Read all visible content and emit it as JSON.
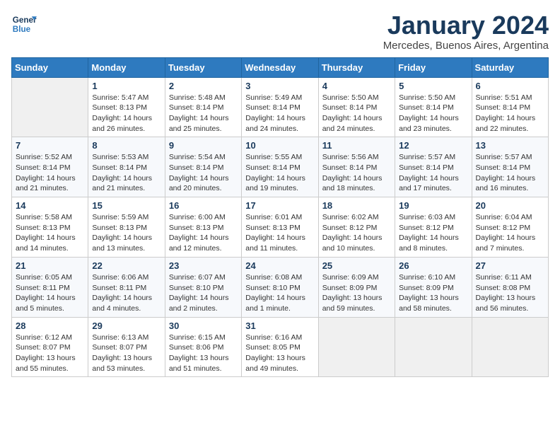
{
  "header": {
    "logo_general": "General",
    "logo_blue": "Blue",
    "month_title": "January 2024",
    "location": "Mercedes, Buenos Aires, Argentina"
  },
  "weekdays": [
    "Sunday",
    "Monday",
    "Tuesday",
    "Wednesday",
    "Thursday",
    "Friday",
    "Saturday"
  ],
  "weeks": [
    [
      {
        "day": "",
        "sunrise": "",
        "sunset": "",
        "daylight": ""
      },
      {
        "day": "1",
        "sunrise": "Sunrise: 5:47 AM",
        "sunset": "Sunset: 8:13 PM",
        "daylight": "Daylight: 14 hours and 26 minutes."
      },
      {
        "day": "2",
        "sunrise": "Sunrise: 5:48 AM",
        "sunset": "Sunset: 8:14 PM",
        "daylight": "Daylight: 14 hours and 25 minutes."
      },
      {
        "day": "3",
        "sunrise": "Sunrise: 5:49 AM",
        "sunset": "Sunset: 8:14 PM",
        "daylight": "Daylight: 14 hours and 24 minutes."
      },
      {
        "day": "4",
        "sunrise": "Sunrise: 5:50 AM",
        "sunset": "Sunset: 8:14 PM",
        "daylight": "Daylight: 14 hours and 24 minutes."
      },
      {
        "day": "5",
        "sunrise": "Sunrise: 5:50 AM",
        "sunset": "Sunset: 8:14 PM",
        "daylight": "Daylight: 14 hours and 23 minutes."
      },
      {
        "day": "6",
        "sunrise": "Sunrise: 5:51 AM",
        "sunset": "Sunset: 8:14 PM",
        "daylight": "Daylight: 14 hours and 22 minutes."
      }
    ],
    [
      {
        "day": "7",
        "sunrise": "Sunrise: 5:52 AM",
        "sunset": "Sunset: 8:14 PM",
        "daylight": "Daylight: 14 hours and 21 minutes."
      },
      {
        "day": "8",
        "sunrise": "Sunrise: 5:53 AM",
        "sunset": "Sunset: 8:14 PM",
        "daylight": "Daylight: 14 hours and 21 minutes."
      },
      {
        "day": "9",
        "sunrise": "Sunrise: 5:54 AM",
        "sunset": "Sunset: 8:14 PM",
        "daylight": "Daylight: 14 hours and 20 minutes."
      },
      {
        "day": "10",
        "sunrise": "Sunrise: 5:55 AM",
        "sunset": "Sunset: 8:14 PM",
        "daylight": "Daylight: 14 hours and 19 minutes."
      },
      {
        "day": "11",
        "sunrise": "Sunrise: 5:56 AM",
        "sunset": "Sunset: 8:14 PM",
        "daylight": "Daylight: 14 hours and 18 minutes."
      },
      {
        "day": "12",
        "sunrise": "Sunrise: 5:57 AM",
        "sunset": "Sunset: 8:14 PM",
        "daylight": "Daylight: 14 hours and 17 minutes."
      },
      {
        "day": "13",
        "sunrise": "Sunrise: 5:57 AM",
        "sunset": "Sunset: 8:14 PM",
        "daylight": "Daylight: 14 hours and 16 minutes."
      }
    ],
    [
      {
        "day": "14",
        "sunrise": "Sunrise: 5:58 AM",
        "sunset": "Sunset: 8:13 PM",
        "daylight": "Daylight: 14 hours and 14 minutes."
      },
      {
        "day": "15",
        "sunrise": "Sunrise: 5:59 AM",
        "sunset": "Sunset: 8:13 PM",
        "daylight": "Daylight: 14 hours and 13 minutes."
      },
      {
        "day": "16",
        "sunrise": "Sunrise: 6:00 AM",
        "sunset": "Sunset: 8:13 PM",
        "daylight": "Daylight: 14 hours and 12 minutes."
      },
      {
        "day": "17",
        "sunrise": "Sunrise: 6:01 AM",
        "sunset": "Sunset: 8:13 PM",
        "daylight": "Daylight: 14 hours and 11 minutes."
      },
      {
        "day": "18",
        "sunrise": "Sunrise: 6:02 AM",
        "sunset": "Sunset: 8:12 PM",
        "daylight": "Daylight: 14 hours and 10 minutes."
      },
      {
        "day": "19",
        "sunrise": "Sunrise: 6:03 AM",
        "sunset": "Sunset: 8:12 PM",
        "daylight": "Daylight: 14 hours and 8 minutes."
      },
      {
        "day": "20",
        "sunrise": "Sunrise: 6:04 AM",
        "sunset": "Sunset: 8:12 PM",
        "daylight": "Daylight: 14 hours and 7 minutes."
      }
    ],
    [
      {
        "day": "21",
        "sunrise": "Sunrise: 6:05 AM",
        "sunset": "Sunset: 8:11 PM",
        "daylight": "Daylight: 14 hours and 5 minutes."
      },
      {
        "day": "22",
        "sunrise": "Sunrise: 6:06 AM",
        "sunset": "Sunset: 8:11 PM",
        "daylight": "Daylight: 14 hours and 4 minutes."
      },
      {
        "day": "23",
        "sunrise": "Sunrise: 6:07 AM",
        "sunset": "Sunset: 8:10 PM",
        "daylight": "Daylight: 14 hours and 2 minutes."
      },
      {
        "day": "24",
        "sunrise": "Sunrise: 6:08 AM",
        "sunset": "Sunset: 8:10 PM",
        "daylight": "Daylight: 14 hours and 1 minute."
      },
      {
        "day": "25",
        "sunrise": "Sunrise: 6:09 AM",
        "sunset": "Sunset: 8:09 PM",
        "daylight": "Daylight: 13 hours and 59 minutes."
      },
      {
        "day": "26",
        "sunrise": "Sunrise: 6:10 AM",
        "sunset": "Sunset: 8:09 PM",
        "daylight": "Daylight: 13 hours and 58 minutes."
      },
      {
        "day": "27",
        "sunrise": "Sunrise: 6:11 AM",
        "sunset": "Sunset: 8:08 PM",
        "daylight": "Daylight: 13 hours and 56 minutes."
      }
    ],
    [
      {
        "day": "28",
        "sunrise": "Sunrise: 6:12 AM",
        "sunset": "Sunset: 8:07 PM",
        "daylight": "Daylight: 13 hours and 55 minutes."
      },
      {
        "day": "29",
        "sunrise": "Sunrise: 6:13 AM",
        "sunset": "Sunset: 8:07 PM",
        "daylight": "Daylight: 13 hours and 53 minutes."
      },
      {
        "day": "30",
        "sunrise": "Sunrise: 6:15 AM",
        "sunset": "Sunset: 8:06 PM",
        "daylight": "Daylight: 13 hours and 51 minutes."
      },
      {
        "day": "31",
        "sunrise": "Sunrise: 6:16 AM",
        "sunset": "Sunset: 8:05 PM",
        "daylight": "Daylight: 13 hours and 49 minutes."
      },
      {
        "day": "",
        "sunrise": "",
        "sunset": "",
        "daylight": ""
      },
      {
        "day": "",
        "sunrise": "",
        "sunset": "",
        "daylight": ""
      },
      {
        "day": "",
        "sunrise": "",
        "sunset": "",
        "daylight": ""
      }
    ]
  ]
}
